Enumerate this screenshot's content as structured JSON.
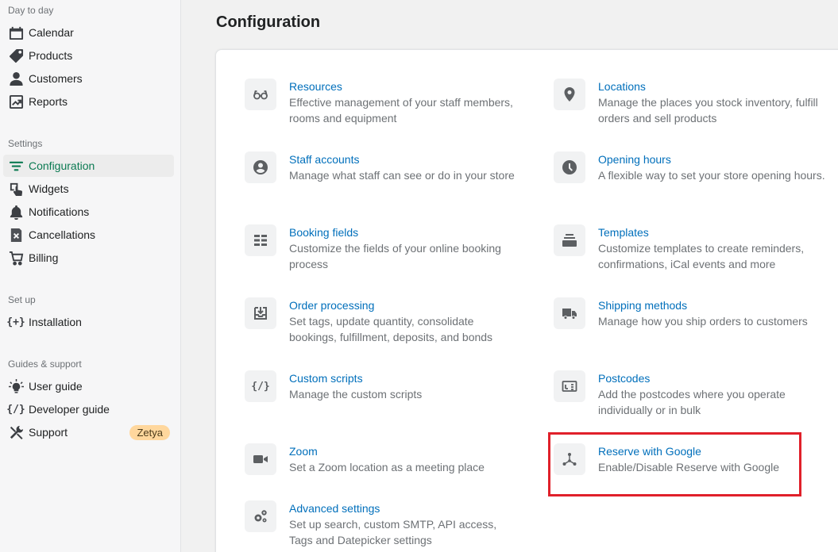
{
  "sidebar": {
    "day_to_day": {
      "title": "Day to day",
      "items": [
        {
          "label": "Calendar",
          "icon": "calendar-icon"
        },
        {
          "label": "Products",
          "icon": "tag-icon"
        },
        {
          "label": "Customers",
          "icon": "person-icon"
        },
        {
          "label": "Reports",
          "icon": "chart-icon"
        }
      ]
    },
    "settings": {
      "title": "Settings",
      "items": [
        {
          "label": "Configuration",
          "icon": "sliders-icon",
          "active": true
        },
        {
          "label": "Widgets",
          "icon": "widget-icon"
        },
        {
          "label": "Notifications",
          "icon": "bell-icon"
        },
        {
          "label": "Cancellations",
          "icon": "cancel-icon"
        },
        {
          "label": "Billing",
          "icon": "cart-icon"
        }
      ]
    },
    "set_up": {
      "title": "Set up",
      "items": [
        {
          "label": "Installation",
          "icon": "install-icon",
          "glyph": "{+}"
        }
      ]
    },
    "guides": {
      "title": "Guides & support",
      "items": [
        {
          "label": "User guide",
          "icon": "lightbulb-icon"
        },
        {
          "label": "Developer guide",
          "icon": "code-icon",
          "glyph": "{/}"
        },
        {
          "label": "Support",
          "icon": "tools-icon",
          "badge": "Zetya"
        }
      ]
    }
  },
  "page": {
    "title": "Configuration"
  },
  "config": {
    "left": [
      {
        "title": "Resources",
        "desc": "Effective management of your staff members, rooms and equipment",
        "icon": "glasses-icon"
      },
      {
        "title": "Staff accounts",
        "desc": "Manage what staff can see or do in your store",
        "icon": "account-icon"
      },
      {
        "title": "Booking fields",
        "desc": "Customize the fields of your online booking process",
        "icon": "form-icon"
      },
      {
        "title": "Order processing",
        "desc": "Set tags, update quantity, consolidate bookings, fulfillment, deposits, and bonds",
        "icon": "inbox-download-icon"
      },
      {
        "title": "Custom scripts",
        "desc": "Manage the custom scripts",
        "icon": "code-icon",
        "glyph": "{/}"
      },
      {
        "title": "Zoom",
        "desc": "Set a Zoom location as a meeting place",
        "icon": "video-icon"
      },
      {
        "title": "Advanced settings",
        "desc": "Set up search, custom SMTP, API access, Tags and Datepicker settings",
        "icon": "gears-icon"
      }
    ],
    "right": [
      {
        "title": "Locations",
        "desc": "Manage the places you stock inventory, fulfill orders and sell products",
        "icon": "location-pin-icon"
      },
      {
        "title": "Opening hours",
        "desc": "A flexible way to set your store opening hours.",
        "icon": "clock-icon"
      },
      {
        "title": "Templates",
        "desc": "Customize templates to create reminders, confirmations, iCal events and more",
        "icon": "stack-icon"
      },
      {
        "title": "Shipping methods",
        "desc": "Manage how you ship orders to customers",
        "icon": "truck-icon"
      },
      {
        "title": "Postcodes",
        "desc": "Add the postcodes where you operate individually or in bulk",
        "icon": "postcode-icon"
      },
      {
        "title": "Reserve with Google",
        "desc": "Enable/Disable Reserve with Google",
        "icon": "network-icon"
      }
    ]
  },
  "colors": {
    "link": "#006fbb",
    "active": "#0b7a52",
    "highlight": "#e0202a",
    "badge": "#ffd79d"
  }
}
